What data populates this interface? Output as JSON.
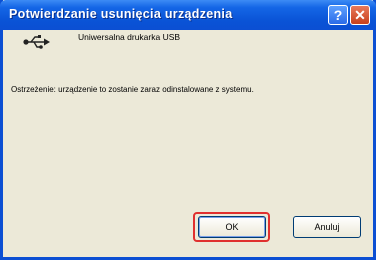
{
  "window": {
    "title": "Potwierdzanie usunięcia urządzenia",
    "help_label": "?",
    "close_label": "✕"
  },
  "device": {
    "icon": "usb-icon",
    "name": "Uniwersalna drukarka USB"
  },
  "message": "Ostrzeżenie: urządzenie to zostanie zaraz odinstalowane z systemu.",
  "buttons": {
    "ok_label": "OK",
    "cancel_label": "Anuluj"
  },
  "colors": {
    "titlebar": "#0b4fd3",
    "dialog_bg": "#ece9d8",
    "highlight": "#e0302f"
  }
}
